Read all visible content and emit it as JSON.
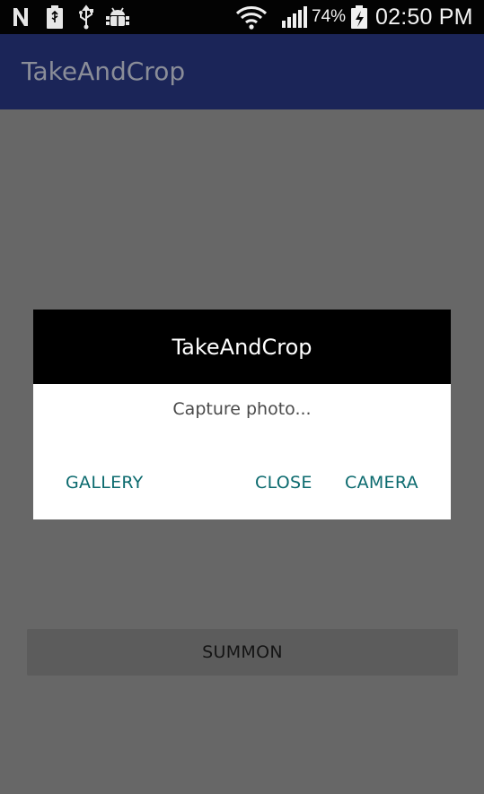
{
  "status_bar": {
    "icons_left": [
      "n-icon",
      "battery-usb-icon",
      "usb-icon",
      "android-debug-icon"
    ],
    "icons_right": [
      "wifi-icon",
      "signal-icon",
      "battery-charging-icon"
    ],
    "battery_percent": "74%",
    "time": "02:50 PM"
  },
  "app_bar": {
    "title": "TakeAndCrop"
  },
  "dialog": {
    "title": "TakeAndCrop",
    "message": "Capture photo...",
    "buttons": {
      "gallery": "GALLERY",
      "close": "CLOSE",
      "camera": "CAMERA"
    }
  },
  "main": {
    "summon_label": "SUMMON"
  },
  "colors": {
    "scrim": "#676767",
    "app_bar": "#1b2558",
    "dialog_button_text": "#0b6a6e"
  }
}
